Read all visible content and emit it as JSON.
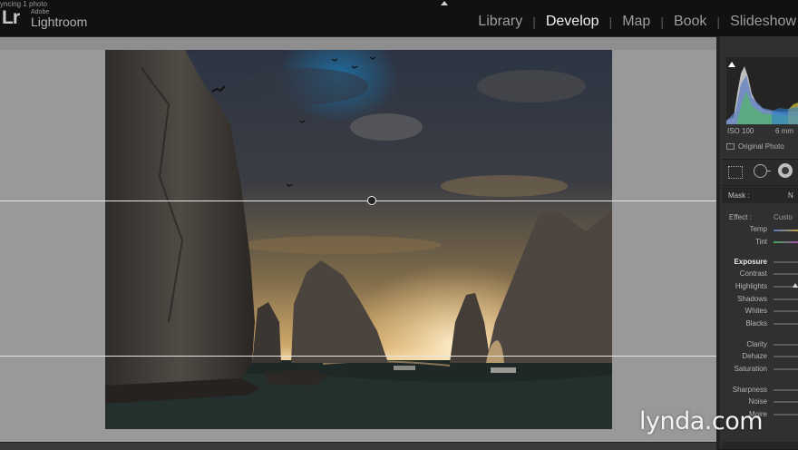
{
  "status": {
    "text": "yncing 1 photo"
  },
  "app": {
    "logo": "Lr",
    "vendor": "Adobe",
    "name": "Lightroom"
  },
  "modules": [
    {
      "label": "Library",
      "active": false
    },
    {
      "label": "Develop",
      "active": true
    },
    {
      "label": "Map",
      "active": false
    },
    {
      "label": "Book",
      "active": false
    },
    {
      "label": "Slideshow",
      "active": false
    }
  ],
  "histogram": {
    "iso": "ISO 100",
    "focal": "6 mm",
    "original_photo_label": "Original Photo"
  },
  "mask": {
    "label": "Mask :",
    "value": "N"
  },
  "effect": {
    "label": "Effect :",
    "value": "Custo"
  },
  "sliders": {
    "temp": "Temp",
    "tint": "Tint",
    "exposure": "Exposure",
    "contrast": "Contrast",
    "highlights": "Highlights",
    "shadows": "Shadows",
    "whites": "Whites",
    "blacks": "Blacks",
    "clarity": "Clarity",
    "dehaze": "Dehaze",
    "saturation": "Saturation",
    "sharpness": "Sharpness",
    "noise": "Noise",
    "moire": "Moire"
  },
  "watermark": "lynda.com",
  "icons": {
    "collapse": "triangle-up-icon",
    "crop": "crop-overlay-icon",
    "spot": "spot-removal-icon",
    "redeye": "red-eye-icon",
    "clipping": "clipping-indicator-icon"
  }
}
